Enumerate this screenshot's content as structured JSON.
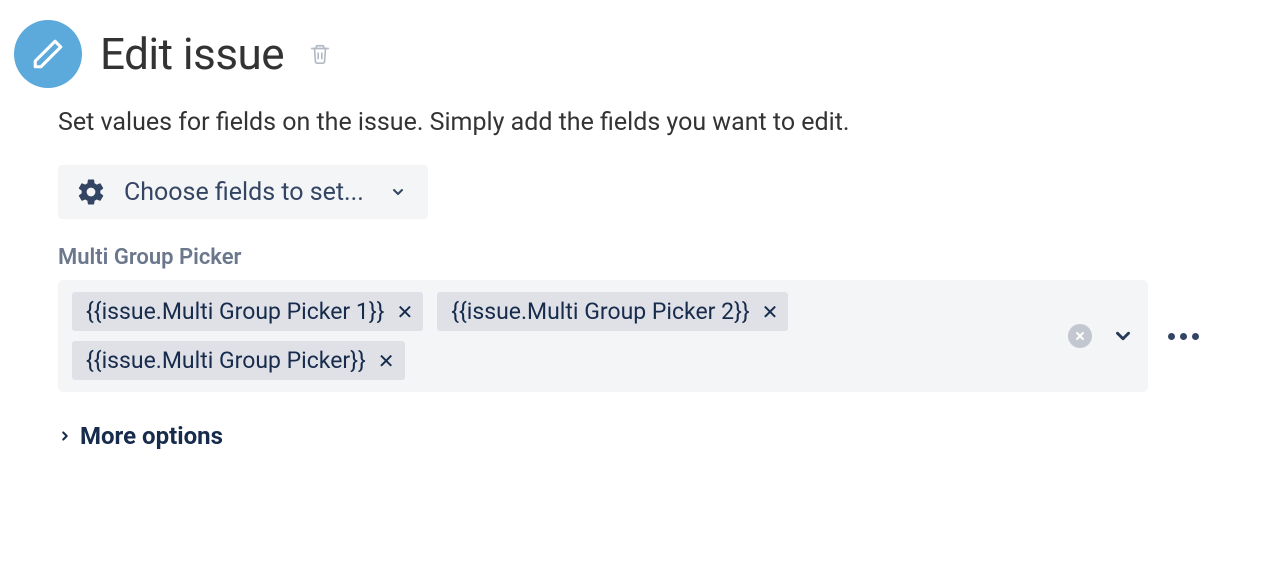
{
  "header": {
    "title": "Edit issue"
  },
  "description": "Set values for fields on the issue. Simply add the fields you want to edit.",
  "chooseFields": {
    "label": "Choose fields to set..."
  },
  "field": {
    "label": "Multi Group Picker",
    "tags": [
      "{{issue.Multi Group Picker 1}}",
      "{{issue.Multi Group Picker 2}}",
      "{{issue.Multi Group Picker}}"
    ]
  },
  "moreOptions": {
    "label": "More options"
  }
}
